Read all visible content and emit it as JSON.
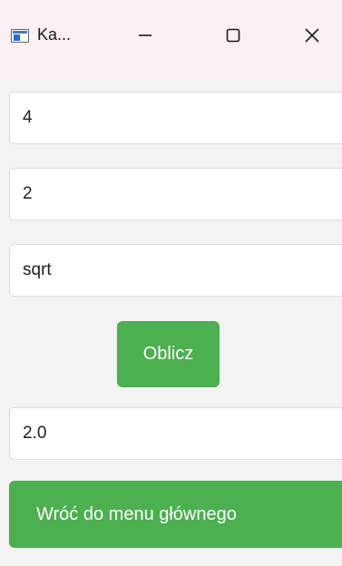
{
  "window": {
    "title": "Ka...",
    "controls": {
      "minimize": "minimize-icon",
      "maximize": "maximize-icon",
      "close": "close-icon"
    }
  },
  "form": {
    "first_value": "4",
    "second_value": "2",
    "operation": "sqrt",
    "calculate_label": "Oblicz",
    "result": "2.0",
    "back_label": "Wróć do menu głównego"
  },
  "colors": {
    "accent": "#4caf50",
    "titlebar": "#fbf0f3",
    "background": "#f3f3f3"
  }
}
